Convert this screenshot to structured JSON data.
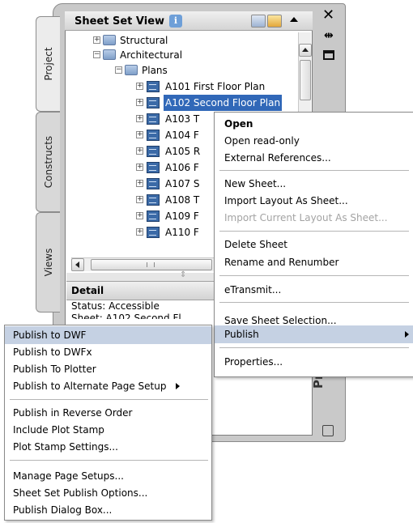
{
  "tabs": [
    "Project",
    "Constructs",
    "Views"
  ],
  "palette_title": "Projec",
  "panel": {
    "title": "Sheet Set View",
    "info_badge": "i"
  },
  "tree": {
    "groups": [
      {
        "label": "Structural"
      },
      {
        "label": "Architectural"
      },
      {
        "label": "Plans"
      }
    ],
    "sheets": [
      "A101 First Floor Plan",
      "A102 Second Floor Plan",
      "A103 T",
      "A104 F",
      "A105 R",
      "A106 F",
      "A107 S",
      "A108 T",
      "A109 F",
      "A110 F"
    ],
    "selected_sheet": "A102 Second Floor Plan"
  },
  "detail": {
    "title": "Detail",
    "status_line": "Status: Accessible",
    "sheet_line": "Sheet: A102 Second Fl"
  },
  "context_menu": {
    "items": [
      {
        "label": "Open",
        "bold": true
      },
      {
        "label": "Open read-only"
      },
      {
        "label": "External References..."
      },
      {
        "label": "New Sheet..."
      },
      {
        "label": "Import Layout As Sheet..."
      },
      {
        "label": "Import Current Layout As Sheet...",
        "disabled": true
      },
      {
        "label": "Delete Sheet"
      },
      {
        "label": "Rename and Renumber"
      },
      {
        "label": "eTransmit..."
      },
      {
        "label": "Save Sheet Selection..."
      },
      {
        "label": "Publish",
        "highlighted": true,
        "submenu": true
      },
      {
        "label": "Properties..."
      }
    ]
  },
  "publish_submenu": {
    "items": [
      {
        "label": "Publish to DWF",
        "highlighted": true
      },
      {
        "label": "Publish to DWFx"
      },
      {
        "label": "Publish To Plotter"
      },
      {
        "label": "Publish to Alternate Page Setup",
        "submenu": true
      },
      {
        "label": "Publish in Reverse Order"
      },
      {
        "label": "Include Plot Stamp"
      },
      {
        "label": "Plot Stamp Settings..."
      },
      {
        "label": "Manage Page Setups..."
      },
      {
        "label": "Sheet Set Publish Options..."
      },
      {
        "label": "Publish Dialog Box..."
      }
    ]
  },
  "colors": {
    "selection": "#3168b8",
    "menu_highlight": "#c5d1e3",
    "disabled_text": "#a3a3a3"
  }
}
